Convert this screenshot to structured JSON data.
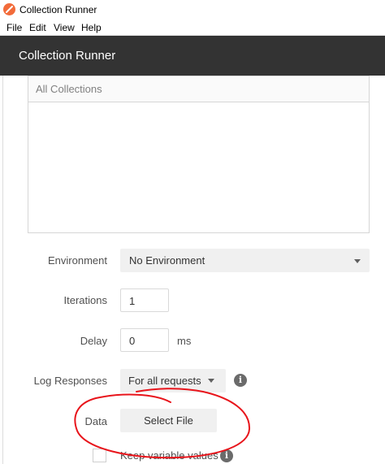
{
  "window": {
    "title": "Collection Runner"
  },
  "menu": {
    "items": [
      "File",
      "Edit",
      "View",
      "Help"
    ]
  },
  "header": {
    "title": "Collection Runner"
  },
  "collections": {
    "header": "All Collections"
  },
  "form": {
    "environment": {
      "label": "Environment",
      "value": "No Environment"
    },
    "iterations": {
      "label": "Iterations",
      "value": "1"
    },
    "delay": {
      "label": "Delay",
      "value": "0",
      "unit": "ms"
    },
    "log_responses": {
      "label": "Log Responses",
      "value": "For all requests"
    },
    "data": {
      "label": "Data",
      "button": "Select File"
    },
    "keep_variable_values": {
      "label": "Keep variable values",
      "checked": false
    }
  },
  "colors": {
    "header_bg": "#333333",
    "brand": "#f26b3a",
    "annotation": "#e8141b"
  }
}
